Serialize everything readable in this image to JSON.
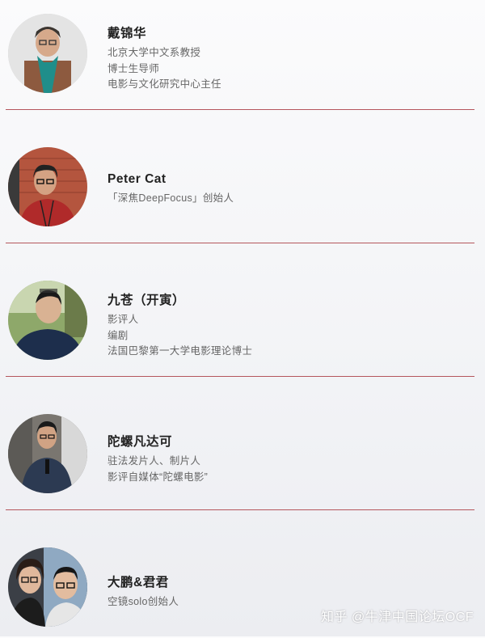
{
  "people": [
    {
      "name": "戴锦华",
      "lines": [
        "北京大学中文系教授",
        "博士生导师",
        "电影与文化研究中心主任"
      ],
      "avatar": "portrait-woman-teal-scarf"
    },
    {
      "name": "Peter Cat",
      "lines": [
        "「深焦DeepFocus」创始人"
      ],
      "avatar": "portrait-man-glasses-brick-wall"
    },
    {
      "name": "九苍（开寅）",
      "lines": [
        "影评人",
        "编剧",
        "法国巴黎第一大学电影理论博士"
      ],
      "avatar": "portrait-man-navy-jacket"
    },
    {
      "name": "陀螺凡达可",
      "lines": [
        "驻法发片人、制片人",
        "影评自媒体“陀螺电影”"
      ],
      "avatar": "portrait-man-microphone"
    },
    {
      "name": "大鹏&君君",
      "lines": [
        "空镜solo创始人"
      ],
      "avatar": "portrait-couple-selfie"
    }
  ],
  "watermark": "知乎 @牛津中国论坛OCF",
  "colors": {
    "divider": "#b5565c",
    "name": "#222222",
    "subtitle": "#666666"
  }
}
